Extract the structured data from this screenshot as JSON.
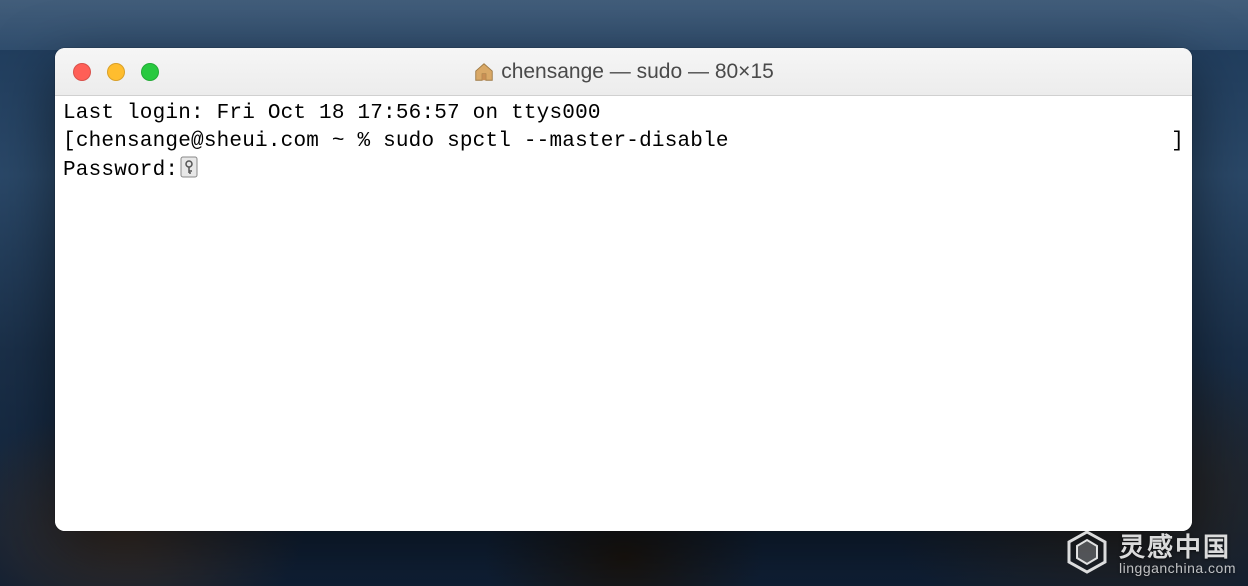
{
  "window": {
    "title": "chensange — sudo — 80×15"
  },
  "terminal": {
    "last_login": "Last login: Fri Oct 18 17:56:57 on ttys000",
    "prompt_open": "[",
    "prompt_user": "chensange@sheui.com ~ % ",
    "command": "sudo spctl --master-disable",
    "prompt_close": "]",
    "password_label": "Password:"
  },
  "watermark": {
    "cn": "灵感中国",
    "en": "lingganchina.com"
  }
}
